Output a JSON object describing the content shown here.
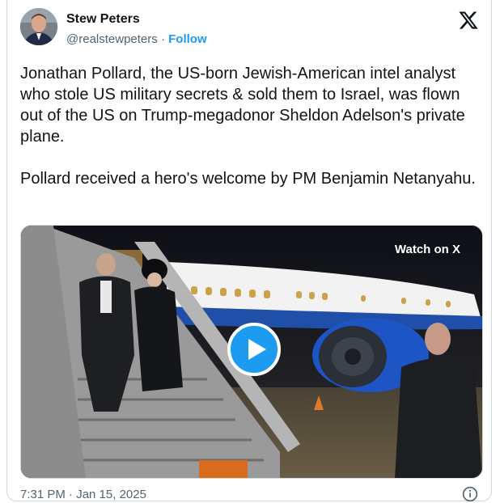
{
  "author": {
    "display_name": "Stew Peters",
    "handle": "@realstewpeters",
    "separator": "·",
    "follow_label": "Follow"
  },
  "tweet": {
    "paragraphs": [
      "Jonathan Pollard, the US-born Jewish-American intel analyst who stole US military secrets & sold them to Israel, was flown out of the US on Trump-megadonor Sheldon Adelson's private plane.",
      "Pollard received a hero's welcome by PM Benjamin Netanyahu."
    ]
  },
  "media": {
    "watch_label": "Watch on X",
    "play_icon": "play-icon"
  },
  "footer": {
    "timestamp": "7:31 PM · Jan 15, 2025",
    "info_icon": "info-icon"
  },
  "colors": {
    "accent": "#1d9bf0",
    "text": "#0f1419",
    "muted": "#536471",
    "border": "#cfd9de"
  }
}
